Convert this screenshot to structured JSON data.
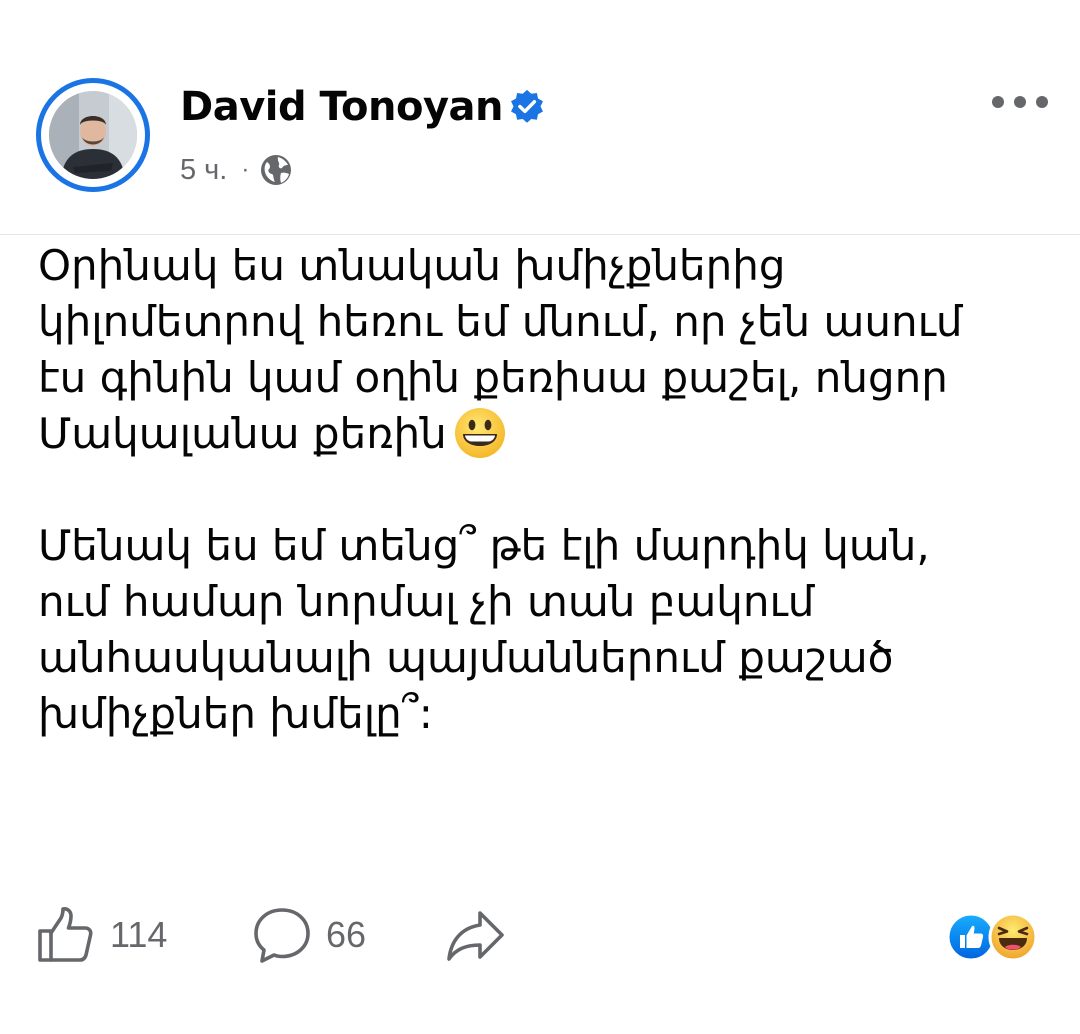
{
  "post": {
    "author": "David Tonoyan",
    "verified": true,
    "time": "5 ч.",
    "separator": "·",
    "visibility_icon": "globe-icon",
    "menu_icon": "more-options-icon",
    "paragraphs": [
      {
        "lines": [
          "Օրինակ ես տնական խմիչքներից",
          "կիլոմետրով հեռու եմ մնում, որ չեն ասում",
          "էս գինին կամ օղին քեռիսա քաշել, ոնցոր",
          "Մակալանա քեռին"
        ],
        "trailing_emoji": "grinning-face-emoji"
      },
      {
        "lines": [
          "Մենակ ես եմ տենց՞ թե էլի մարդիկ կան,",
          "ում համար նորմալ չի տան բակում",
          "անհասկանալի պայմաններում քաշած",
          "խմիչքներ խմելը՞:"
        ]
      }
    ]
  },
  "actions": {
    "like_count": "114",
    "comment_count": "66",
    "like_icon": "thumbs-up-icon",
    "comment_icon": "comment-bubble-icon",
    "share_icon": "share-arrow-icon",
    "reactions": [
      "like-reaction-icon",
      "haha-reaction-icon"
    ]
  },
  "colors": {
    "accent": "#1b74e4",
    "text": "#050505",
    "secondary_text": "#65676b",
    "divider": "#e4e6eb",
    "haha_yellow": "#f7b928"
  }
}
